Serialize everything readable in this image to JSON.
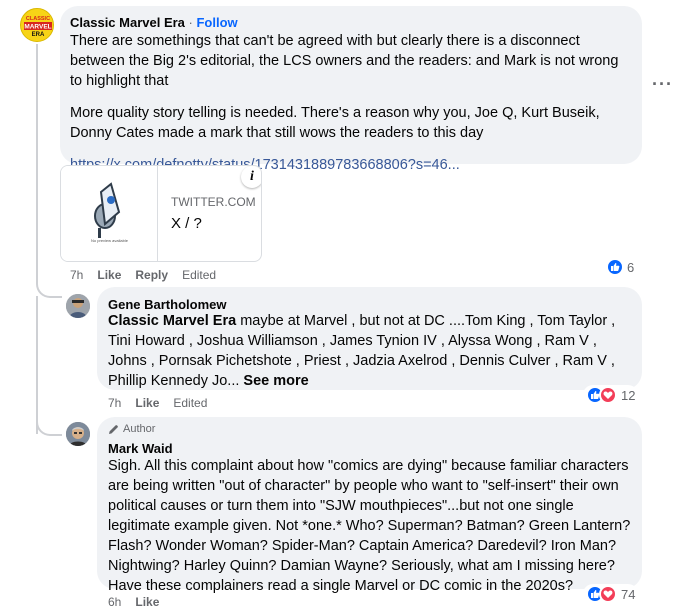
{
  "comments": [
    {
      "author": "Classic Marvel Era",
      "follow": "Follow",
      "paragraphs": [
        "There are somethings that can't be agreed with but clearly there is a disconnect between the Big 2's editorial, the LCS owners and the readers: and Mark is not wrong to highlight that",
        "More quality story telling is needed. There's a reason why you, Joe Q, Kurt Buseik, Donny Cates made a mark that still wows the readers to this day"
      ],
      "link": "https://x.com/defnotty/status/1731431889783668806?s=46...",
      "preview": {
        "domain": "TWITTER.COM",
        "title": "X / ?",
        "image_caption": "No preview available",
        "info_icon": "i"
      },
      "time": "7h",
      "like": "Like",
      "reply": "Reply",
      "edited": "Edited",
      "reaction_count": "6"
    },
    {
      "author": "Gene Bartholomew",
      "mention": "Classic Marvel Era",
      "text": " maybe at Marvel , but not at DC ....Tom King , Tom Taylor , Tini Howard , Joshua Williamson , James Tynion IV , Alyssa Wong , Ram V , Johns , Pornsak Pichetshote , Priest , Jadzia Axelrod , Dennis Culver , Ram V , Phillip Kennedy Jo...",
      "see_more": " See more",
      "time": "7h",
      "like": "Like",
      "edited": "Edited",
      "reaction_count": "12"
    },
    {
      "badge": "Author",
      "author": "Mark Waid",
      "text": "Sigh. All this complaint about how \"comics are dying\" because familiar characters are being written \"out of character\" by people who want to \"self-insert\" their own political causes or turn them into \"SJW mouthpieces\"...but not one single legitimate example given. Not *one.* Who? Superman? Batman? Green Lantern? Flash? Wonder Woman? Spider-Man? Captain America? Daredevil? Iron Man? Nightwing? Harley Quinn? Damian Wayne? Seriously, what am I missing here? Have these complainers read a single Marvel or DC comic in the 2020s?",
      "time": "6h",
      "like": "Like",
      "reaction_count": "74"
    }
  ],
  "more_icon": "···",
  "colors": {
    "like_blue": "#0866ff",
    "love_red": "#f33e58",
    "bubble": "#f0f2f5",
    "meta_gray": "#65676b"
  }
}
